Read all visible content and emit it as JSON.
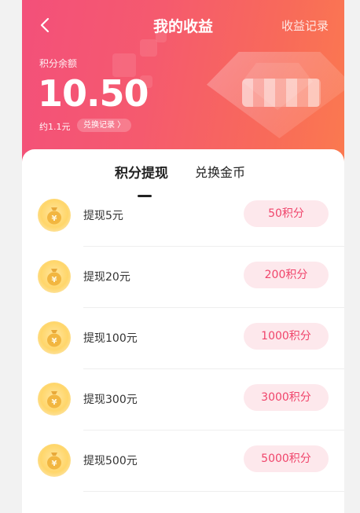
{
  "header": {
    "title": "我的收益",
    "records_link": "收益记录",
    "balance_label": "积分余额",
    "balance_value": "10.50",
    "approx_text": "约1.1元",
    "exchange_records_label": "兑换记录 〉"
  },
  "tabs": [
    {
      "label": "积分提现",
      "active": true
    },
    {
      "label": "兑换金币",
      "active": false
    }
  ],
  "items": [
    {
      "label": "提现5元",
      "points": "50积分"
    },
    {
      "label": "提现20元",
      "points": "200积分"
    },
    {
      "label": "提现100元",
      "points": "1000积分"
    },
    {
      "label": "提现300元",
      "points": "3000积分"
    },
    {
      "label": "提现500元",
      "points": "5000积分"
    }
  ],
  "colors": {
    "header_gradient_start": "#f3507a",
    "header_gradient_end": "#fb7a4f",
    "accent": "#f0456b",
    "pill_bg": "#fde8ec",
    "coin": "#ffd66a"
  },
  "icons": {
    "back": "chevron-left-icon",
    "coin": "money-bag-icon"
  }
}
